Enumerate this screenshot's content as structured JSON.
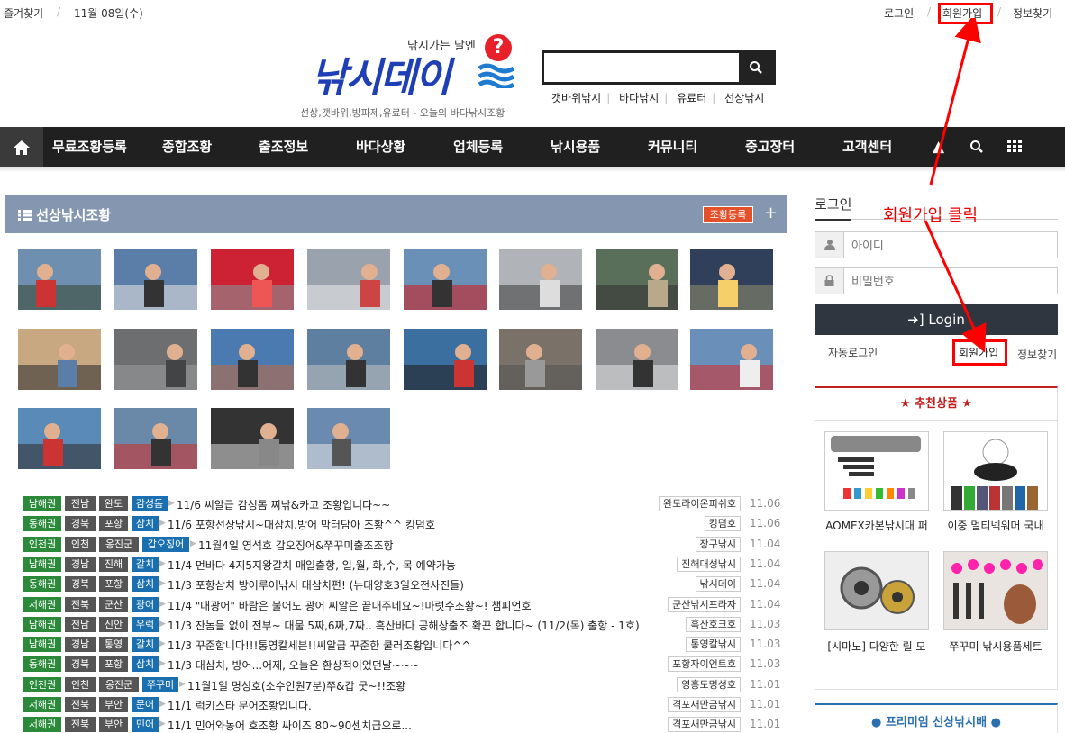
{
  "topbar": {
    "bookmark": "즐겨찾기",
    "date": "11월 08일(수)",
    "login": "로그인",
    "join": "회원가입",
    "find": "정보찾기"
  },
  "logo": {
    "sub": "낚시가는 날엔",
    "main": "낚시데이",
    "q": "?",
    "tagline": "선상,갯바위,방파제,유료터 - 오늘의 바다낚시조황"
  },
  "search": {
    "placeholder": "",
    "links": [
      "갯바위낚시",
      "바다낚시",
      "유료터",
      "선상낚시"
    ]
  },
  "nav": {
    "items": [
      "무료조황등록",
      "종합조황",
      "출조정보",
      "바다상황",
      "업체등록",
      "낚시용품",
      "커뮤니티",
      "중고장터",
      "고객센터"
    ]
  },
  "panel": {
    "title": "선상낚시조황",
    "button": "조황등록",
    "plus": "+"
  },
  "reports": [
    {
      "region": "남해권",
      "area": "전남",
      "city": "완도",
      "fish": "감성돔",
      "title": "11/6 씨알급 감성돔 찌낚&카고 조황입니다~~",
      "source": "완도라이온피쉬호",
      "date": "11.06"
    },
    {
      "region": "동해권",
      "area": "경북",
      "city": "포항",
      "fish": "삼치",
      "title": "11/6 포항선상낚시~대삼치.방어 막터담아 조황^^ 킹덤호",
      "source": "킹덤호",
      "date": "11.06"
    },
    {
      "region": "인천권",
      "area": "인천",
      "city": "옹진군",
      "fish": "갑오징어",
      "title": "11월4일 영석호 갑오징어&쭈꾸미출조조항",
      "source": "장구낚시",
      "date": "11.04"
    },
    {
      "region": "남해권",
      "area": "경남",
      "city": "진해",
      "fish": "갈치",
      "title": "11/4 먼바다 4지5지왕갈치 매일출항, 일,월, 화,수, 목 예약가능",
      "source": "진해대성낚시",
      "date": "11.04"
    },
    {
      "region": "동해권",
      "area": "경북",
      "city": "포항",
      "fish": "삼치",
      "title": "11/3 포항삼치 방어루어낚시 대삼치편! (뉴대양호3일오전사진들)",
      "source": "낚시데이",
      "date": "11.04"
    },
    {
      "region": "서해권",
      "area": "전북",
      "city": "군산",
      "fish": "광어",
      "title": "11/4 \"대광어\" 바람은 불어도 광어 씨알은 끝내주네요~!마럿수조황~! 챔피언호",
      "source": "군산낚시프라자",
      "date": "11.04"
    },
    {
      "region": "남해권",
      "area": "전남",
      "city": "신안",
      "fish": "우럭",
      "title": "11/3 잔놈들 없이 전부~ 대물 5짜,6짜,7짜.. 흑산바다 공해상출조 확끈 합니다~ (11/2(목) 출항 - 1호)",
      "source": "흑산호크호",
      "date": "11.03"
    },
    {
      "region": "남해권",
      "area": "경남",
      "city": "통영",
      "fish": "갈치",
      "title": "11/3 꾸준합니다!!!통영칼세븐!!씨알급 꾸준한 쿨러조황입니다^^",
      "source": "통영칼낚시",
      "date": "11.03"
    },
    {
      "region": "동해권",
      "area": "경북",
      "city": "포항",
      "fish": "삼치",
      "title": "11/3 대삼치, 방어...어제, 오늘은 환상적이었던날~~~",
      "source": "포항자이언트호",
      "date": "11.03"
    },
    {
      "region": "인천권",
      "area": "인천",
      "city": "옹진군",
      "fish": "쭈꾸미",
      "title": "11월1일 명성호(소수인원7분)쭈&갑 굿~!!조황",
      "source": "영흥도명성호",
      "date": "11.01"
    },
    {
      "region": "서해권",
      "area": "전북",
      "city": "부안",
      "fish": "문어",
      "title": "11/1 럭키스타 문어조황입니다.",
      "source": "격포새만금낚시",
      "date": "11.01"
    },
    {
      "region": "서해권",
      "area": "전북",
      "city": "부안",
      "fish": "민어",
      "title": "11/1 민어와농어 호조황 싸이즈 80~90센치급으로...",
      "source": "격포새만금낚시",
      "date": "11.01"
    }
  ],
  "login": {
    "title": "로그인",
    "id_placeholder": "아이디",
    "pw_placeholder": "비밀번호",
    "button": "Login",
    "auto": "자동로그인",
    "join": "회원가입",
    "find": "정보찾기"
  },
  "annotation": "회원가입 클릭",
  "recommend": {
    "title": "★ 추천상품 ★",
    "products": [
      "AOMEX카본낚시대 퍼",
      "이중 멀티넥워머 국내",
      "[시마노] 다양한 릴 모",
      "쭈꾸미 낚시용품세트"
    ]
  },
  "premium": {
    "title": "● 프리미엄 선상낚시배 ●"
  },
  "colors": {
    "accent_red": "#ff0000",
    "nav_bg": "#202020",
    "panel_head": "#8496b0",
    "tag_green": "#2a8a3a",
    "tag_blue": "#1a6fb0"
  }
}
